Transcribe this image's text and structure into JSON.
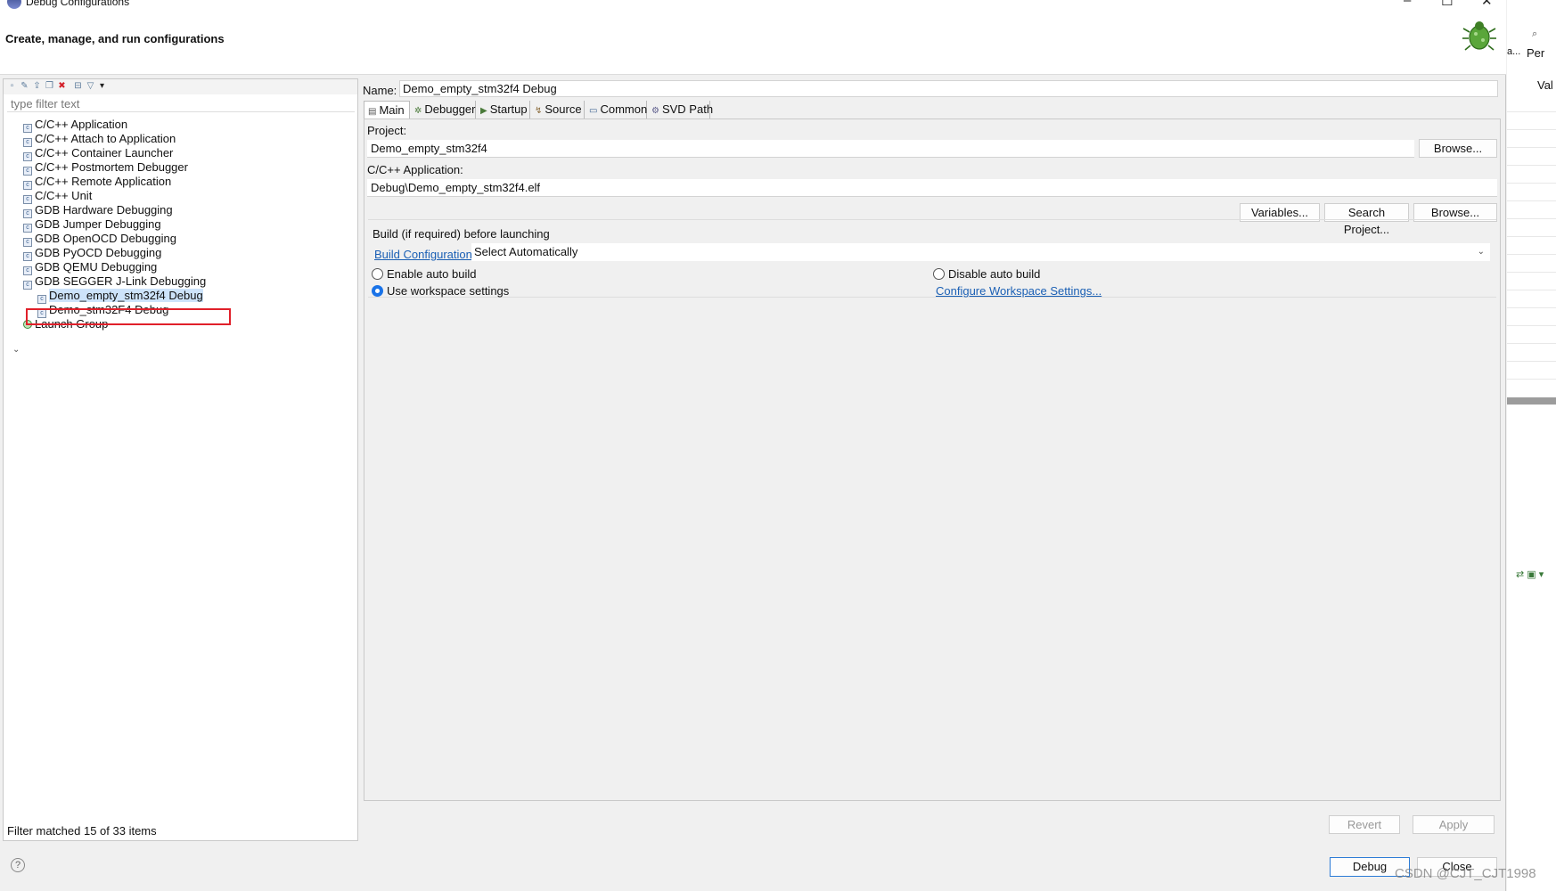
{
  "window": {
    "title": "Debug Configurations",
    "heading": "Create, manage, and run configurations"
  },
  "filter": {
    "placeholder": "type filter text",
    "status": "Filter matched 15 of 33 items"
  },
  "tree": [
    {
      "label": "C/C++ Application",
      "icon": "c-app-icon",
      "indent": 0
    },
    {
      "label": "C/C++ Attach to Application",
      "icon": "c-attach-icon",
      "indent": 0
    },
    {
      "label": "C/C++ Container Launcher",
      "icon": "c-container-icon",
      "indent": 0
    },
    {
      "label": "C/C++ Postmortem Debugger",
      "icon": "c-postmortem-icon",
      "indent": 0
    },
    {
      "label": "C/C++ Remote Application",
      "icon": "c-remote-icon",
      "indent": 0
    },
    {
      "label": "C/C++ Unit",
      "icon": "c-unit-icon",
      "indent": 0
    },
    {
      "label": "GDB Hardware Debugging",
      "icon": "gdb-hw-icon",
      "indent": 0
    },
    {
      "label": "GDB Jumper Debugging",
      "icon": "gdb-jumper-icon",
      "indent": 0
    },
    {
      "label": "GDB OpenOCD Debugging",
      "icon": "gdb-openocd-icon",
      "indent": 0
    },
    {
      "label": "GDB PyOCD Debugging",
      "icon": "gdb-pyocd-icon",
      "indent": 0
    },
    {
      "label": "GDB QEMU Debugging",
      "icon": "gdb-qemu-icon",
      "indent": 0
    },
    {
      "label": "GDB SEGGER J-Link Debugging",
      "icon": "gdb-jlink-icon",
      "indent": 0,
      "expanded": true
    },
    {
      "label": "Demo_empty_stm32f4 Debug",
      "icon": "config-icon",
      "indent": 1,
      "selected": true
    },
    {
      "label": "Demo_stm32F4 Debug",
      "icon": "config-icon",
      "indent": 1
    },
    {
      "label": "Launch Group",
      "icon": "launch-group-icon",
      "indent": 0
    }
  ],
  "config": {
    "name_label": "Name:",
    "name_value": "Demo_empty_stm32f4 Debug",
    "tabs": [
      "Main",
      "Debugger",
      "Startup",
      "Source",
      "Common",
      "SVD Path"
    ],
    "active_tab": "Main",
    "project_label": "Project:",
    "project_value": "Demo_empty_stm32f4",
    "browse_label": "Browse...",
    "app_label": "C/C++ Application:",
    "app_value": "Debug\\Demo_empty_stm32f4.elf",
    "variables_label": "Variables...",
    "search_project_label": "Search Project...",
    "build_group_label": "Build (if required) before launching",
    "build_config_link": "Build Configuration:",
    "build_config_value": "Select Automatically",
    "enable_auto_build": "Enable auto build",
    "disable_auto_build": "Disable auto build",
    "use_workspace": "Use workspace settings",
    "configure_workspace_link": "Configure Workspace Settings...",
    "selected_radio": "Use workspace settings"
  },
  "actions": {
    "revert": "Revert",
    "apply": "Apply",
    "debug": "Debug",
    "close": "Close"
  },
  "background": {
    "per": "Per",
    "val": "Val",
    "a": "a..."
  },
  "watermark": "CSDN @CJT_CJT1998",
  "colors": {
    "accent": "#1a73e8",
    "link": "#1a5fb4",
    "highlight_border": "#e0202a"
  }
}
